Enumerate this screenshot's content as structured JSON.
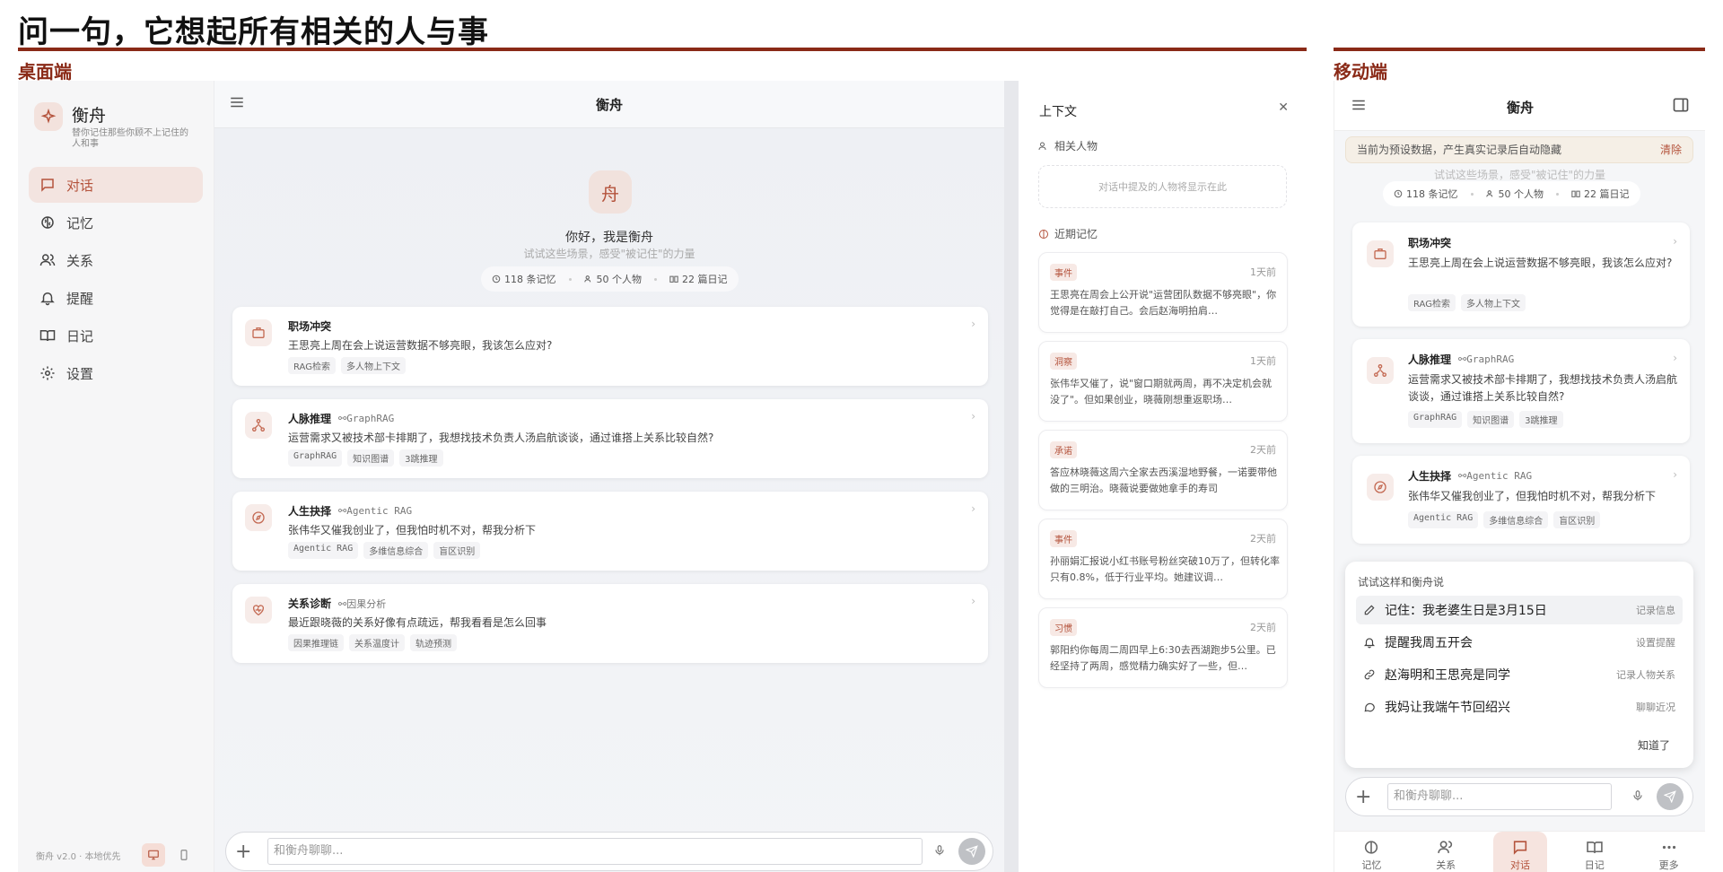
{
  "page": {
    "title": "问一句，它想起所有相关的人与事",
    "desktop_label": "桌面端",
    "mobile_label": "移动端"
  },
  "sidebar": {
    "brand_name": "衡舟",
    "brand_tagline": "替你记住那些你顾不上记住的人和事",
    "items": [
      {
        "label": "对话",
        "icon": "chat-icon",
        "active": true
      },
      {
        "label": "记忆",
        "icon": "brain-icon"
      },
      {
        "label": "关系",
        "icon": "users-icon"
      },
      {
        "label": "提醒",
        "icon": "bell-icon"
      },
      {
        "label": "日记",
        "icon": "book-icon"
      },
      {
        "label": "设置",
        "icon": "gear-icon"
      }
    ],
    "footer": "衡舟 v2.0 · 本地优先"
  },
  "chat": {
    "title": "衡舟",
    "avatar_char": "舟",
    "greeting": "你好，我是衡舟",
    "subtitle": "试试这些场景，感受\"被记住\"的力量",
    "stats": {
      "memories": "118 条记忆",
      "people": "50 个人物",
      "diaries": "22 篇日记"
    },
    "cards": [
      {
        "title": "职场冲突",
        "badge": "",
        "body": "王思亮上周在会上说运营数据不够亮眼，我该怎么应对?",
        "tags": [
          "RAG检索",
          "多人物上下文"
        ],
        "icon": "briefcase-icon"
      },
      {
        "title": "人脉推理",
        "badge": "GraphRAG",
        "body": "运营需求又被技术部卡排期了，我想找技术负责人汤启航谈谈，通过谁搭上关系比较自然?",
        "tags": [
          "GraphRAG",
          "知识图谱",
          "3跳推理"
        ],
        "icon": "network-icon"
      },
      {
        "title": "人生抉择",
        "badge": "Agentic RAG",
        "body": "张伟华又催我创业了，但我怕时机不对，帮我分析下",
        "tags": [
          "Agentic RAG",
          "多维信息综合",
          "盲区识别"
        ],
        "icon": "compass-icon"
      },
      {
        "title": "关系诊断",
        "badge": "因果分析",
        "body": "最近跟晓薇的关系好像有点疏远，帮我看看是怎么回事",
        "tags": [
          "因果推理链",
          "关系温度计",
          "轨迹预测"
        ],
        "icon": "heart-pulse-icon"
      }
    ],
    "input_placeholder": "和衡舟聊聊..."
  },
  "context": {
    "title": "上下文",
    "people_heading": "相关人物",
    "people_empty": "对话中提及的人物将显示在此",
    "memories_heading": "近期记忆",
    "memories": [
      {
        "type": "事件",
        "time": "1天前",
        "text": "王思亮在周会上公开说\"运营团队数据不够亮眼\"，你觉得是在敲打自己。会后赵海明拍肩…"
      },
      {
        "type": "洞察",
        "time": "1天前",
        "text": "张伟华又催了，说\"窗口期就两周，再不决定机会就没了\"。但如果创业，晓薇刚想重返职场…"
      },
      {
        "type": "承诺",
        "time": "2天前",
        "text": "答应林晓薇这周六全家去西溪湿地野餐，一诺要带他做的三明治。晓薇说要做她拿手的寿司"
      },
      {
        "type": "事件",
        "time": "2天前",
        "text": "孙丽娟汇报说小红书账号粉丝突破10万了，但转化率只有0.8%，低于行业平均。她建议调…"
      },
      {
        "type": "习惯",
        "time": "2天前",
        "text": "郭阳约你每周二周四早上6:30去西湖跑步5公里。已经坚持了两周，感觉精力确实好了一些，但…"
      }
    ]
  },
  "mobile": {
    "title": "衡舟",
    "banner": "当前为预设数据，产生真实记录后自动隐藏",
    "banner_action": "清除",
    "subtitle": "试试这些场景，感受\"被记住\"的力量",
    "stats": {
      "memories": "118 条记忆",
      "people": "50 个人物",
      "diaries": "22 篇日记"
    },
    "suggest_title": "试试这样和衡舟说",
    "suggestions": [
      {
        "text": "记住：我老婆生日是3月15日",
        "hint": "记录信息",
        "icon": "pencil-icon"
      },
      {
        "text": "提醒我周五开会",
        "hint": "设置提醒",
        "icon": "bell-icon"
      },
      {
        "text": "赵海明和王思亮是同学",
        "hint": "记录人物关系",
        "icon": "link-icon"
      },
      {
        "text": "我妈让我端午节回绍兴",
        "hint": "聊聊近况",
        "icon": "chat-icon"
      }
    ],
    "got_it": "知道了",
    "input_placeholder": "和衡舟聊聊...",
    "tabs": [
      {
        "label": "记忆",
        "icon": "brain-icon"
      },
      {
        "label": "关系",
        "icon": "users-icon"
      },
      {
        "label": "对话",
        "icon": "chat-icon",
        "active": true
      },
      {
        "label": "日记",
        "icon": "book-icon"
      },
      {
        "label": "更多",
        "icon": "more-icon"
      }
    ]
  },
  "colors": {
    "accent": "#b4533c",
    "rule": "#8a2a17"
  }
}
